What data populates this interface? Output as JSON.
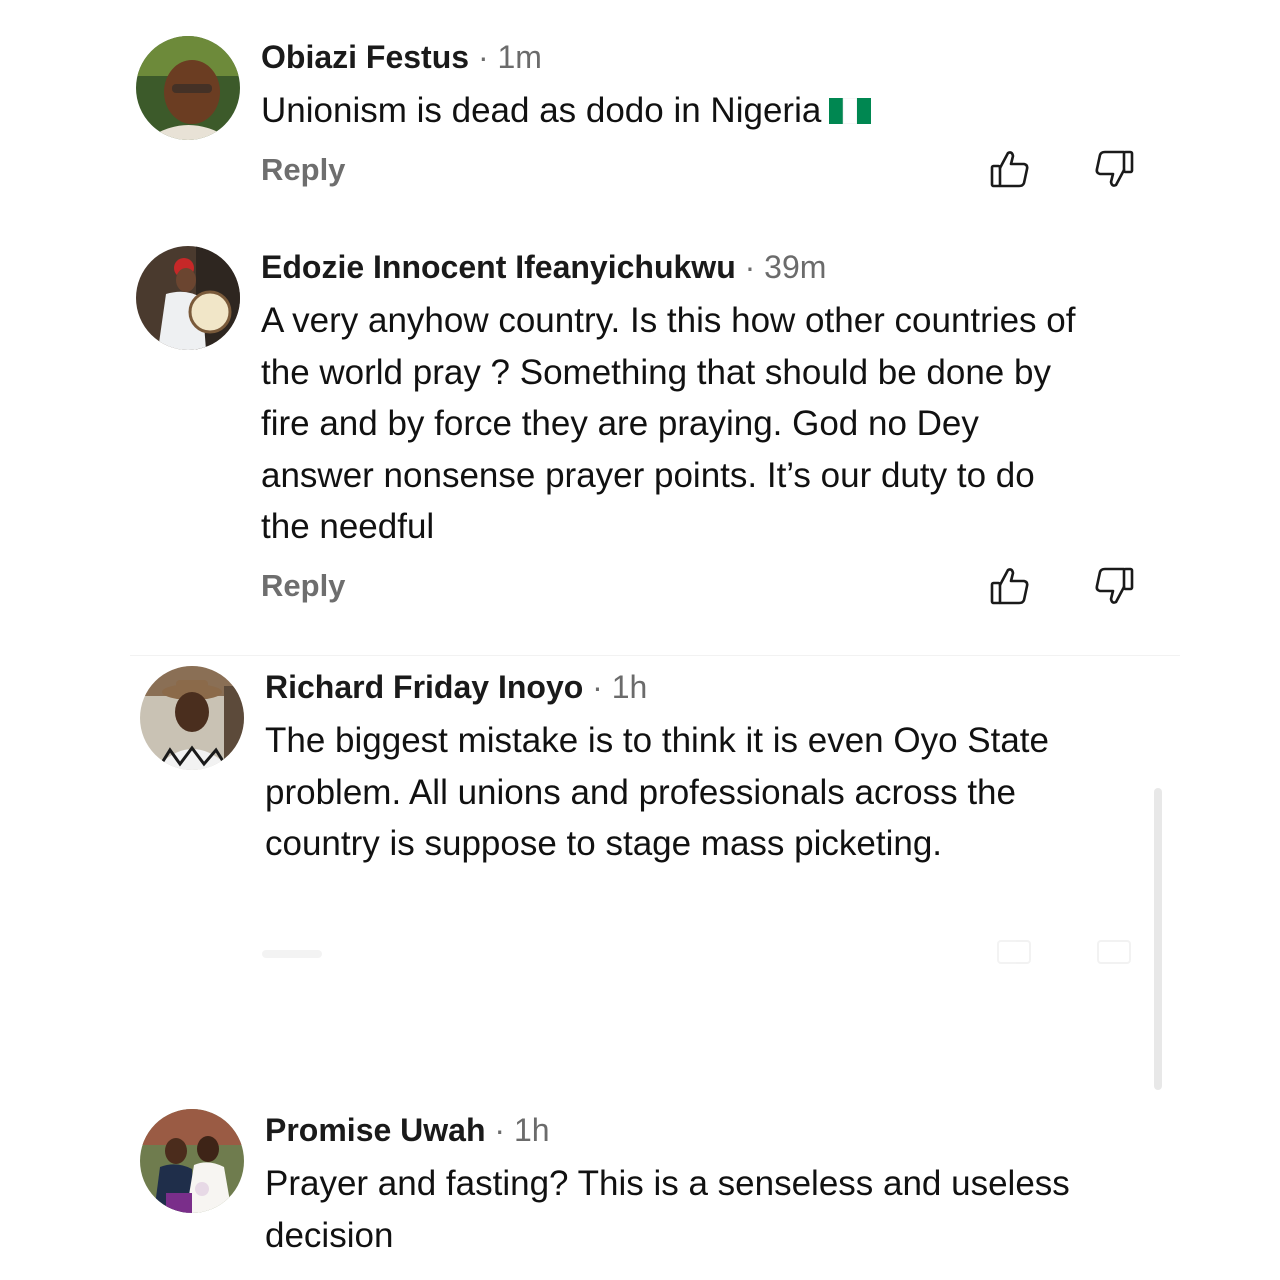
{
  "comments": [
    {
      "author": "Obiazi Festus",
      "separator": "·",
      "time": "1m",
      "text": "Unionism is dead as dodo in Nigeria",
      "flag_icon": "nigeria-flag-icon",
      "reply_label": "Reply"
    },
    {
      "author": "Edozie Innocent Ifeanyichukwu",
      "separator": "·",
      "time": "39m",
      "text": "A very anyhow country. Is this how other countries of the world pray ? Something that should be done by fire and by force they are praying. God no Dey answer nonsense prayer points. It’s our duty to do the needful",
      "reply_label": "Reply"
    },
    {
      "author": "Richard Friday Inoyo",
      "separator": "·",
      "time": "1h",
      "text": "The biggest mistake is to think it is even Oyo State problem. All unions and professionals across the country is suppose to stage mass picketing."
    },
    {
      "author": "Promise Uwah",
      "separator": "·",
      "time": "1h",
      "text": "Prayer and fasting? This is a senseless and useless decision"
    }
  ],
  "icons": {
    "like": "thumbs-up-icon",
    "dislike": "thumbs-down-icon"
  },
  "colors": {
    "flag_green": "#008751",
    "meta_gray": "#6b6b6b",
    "reply_gray": "#6e6e6e"
  }
}
